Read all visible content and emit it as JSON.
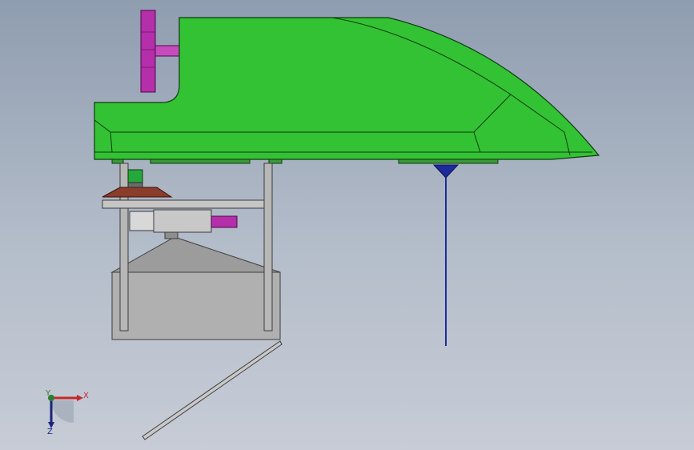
{
  "viewport": {
    "background": "#a9b3c3"
  },
  "model": {
    "hull_color": "#33c233",
    "hull_edge_color": "#0f3a0f",
    "handle_color": "#b52faa",
    "cylinder_color": "#b52faa",
    "strut_color": "#b7b7b7",
    "box_color": "#b0b0b0",
    "flange_color": "#8a3d2a",
    "connector_color": "#26a83a",
    "probe_color": "#1d2a99"
  },
  "triad": {
    "x_label": "X",
    "y_label": "Y",
    "z_label": "Z",
    "x_color": "#c62828",
    "y_color": "#2e7d32",
    "z_color": "#1a237e"
  }
}
